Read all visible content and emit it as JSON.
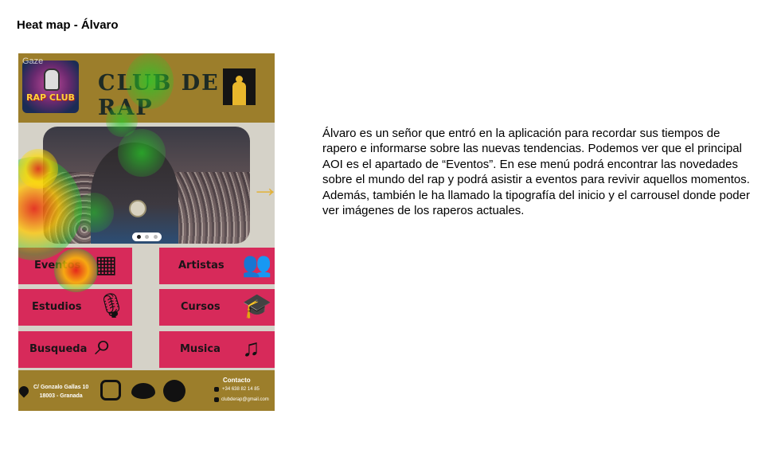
{
  "slide": {
    "title": "Heat map - Álvaro",
    "description": "Álvaro es un señor que entró en la aplicación para recordar sus tiempos de rapero e informarse sobre las nuevas tendencias. Podemos ver que el principal AOI es el apartado de “Eventos”. En ese menú podrá encontrar las novedades sobre el mundo del rap y podrá asistir a eventos para revivir aquellos momentos. Además, también le ha llamado la tipografía del inicio y el carrousel donde poder ver imágenes de los raperos actuales."
  },
  "app": {
    "overlay_label": "Gaze",
    "logo_text": "RAP CLUB",
    "brand_title": "CLUB DE RAP",
    "carousel": {
      "slide_count": 3,
      "active_index": 0,
      "next_icon": "arrow-right-icon"
    },
    "menu": [
      {
        "label": "Eventos",
        "icon": "calendar-icon",
        "glyph": "▦"
      },
      {
        "label": "Artistas",
        "icon": "users-icon",
        "glyph": "👥"
      },
      {
        "label": "Estudios",
        "icon": "microphone-icon",
        "glyph": "🎙"
      },
      {
        "label": "Cursos",
        "icon": "graduation-cap-icon",
        "glyph": "🎓"
      },
      {
        "label": "Busqueda",
        "icon": "search-icon",
        "glyph": "⌕"
      },
      {
        "label": "Musica",
        "icon": "music-note-icon",
        "glyph": "♫"
      }
    ],
    "footer": {
      "address_line1": "C/ Gonzalo Gallas 10",
      "address_line2": "18003 - Granada",
      "social_icons": [
        "instagram-icon",
        "twitter-icon",
        "facebook-icon"
      ],
      "contact_title": "Contacto",
      "phone": "+34 638 82 14 85",
      "email": "clubderap@gmail.com"
    },
    "colors": {
      "header": "#9c7e2b",
      "tile": "#d72a5a",
      "background": "#d5d2c8",
      "accent": "#e2b23b"
    }
  }
}
